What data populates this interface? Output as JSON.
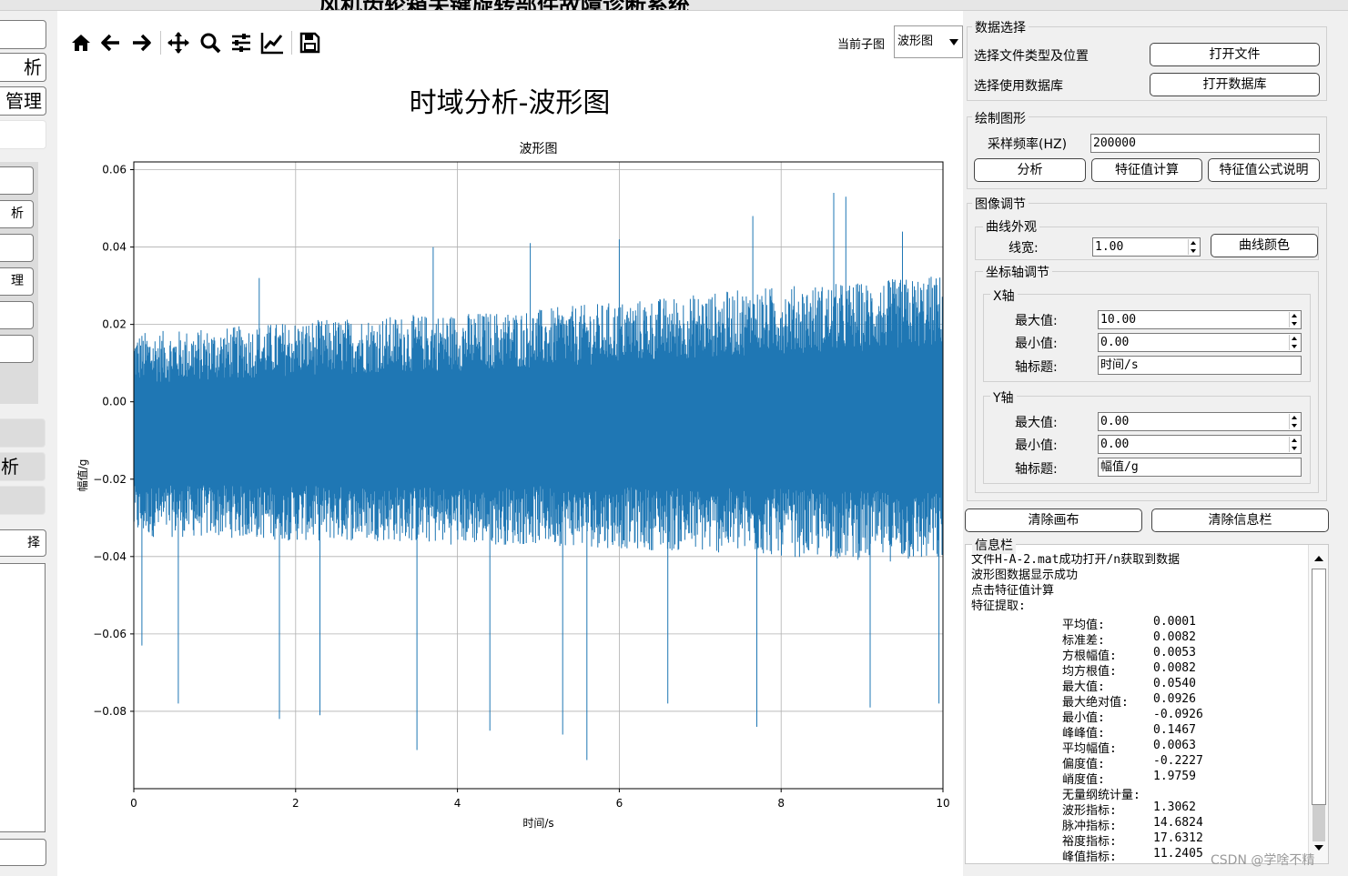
{
  "window": {
    "title": "风机齿轮箱关键旋转部件故障诊断系统"
  },
  "left_nav": {
    "main_buttons": [
      "",
      "析",
      "管理",
      ""
    ],
    "sub_buttons": [
      "",
      "析",
      "",
      "理",
      "",
      ""
    ],
    "gray_buttons": [
      "",
      "析",
      ""
    ],
    "bottom_button": "择"
  },
  "toolbar": {
    "icons": [
      "home-icon",
      "back-arrow-icon",
      "forward-arrow-icon",
      "pan-move-icon",
      "zoom-magnifier-icon",
      "configure-subplots-icon",
      "edit-axes-icon",
      "save-figure-icon"
    ],
    "subplot_label": "当前子图",
    "subplot_value": "波形图"
  },
  "figure": {
    "suptitle": "时域分析-波形图"
  },
  "chart_data": {
    "type": "line",
    "title": "波形图",
    "xlabel": "时间/s",
    "ylabel": "幅值/g",
    "xlim": [
      0,
      10
    ],
    "ylim": [
      -0.1,
      0.062
    ],
    "x_ticks": [
      "0",
      "2",
      "4",
      "6",
      "8",
      "10"
    ],
    "y_ticks": [
      "0.06",
      "0.04",
      "0.02",
      "0.00",
      "−0.02",
      "−0.04",
      "−0.06",
      "−0.08"
    ],
    "grid": true,
    "line_color": "#1f77b4",
    "envelope": {
      "x": [
        0,
        1,
        2,
        3,
        4,
        5,
        6,
        7,
        8,
        9,
        10
      ],
      "upper": [
        0.018,
        0.019,
        0.021,
        0.022,
        0.023,
        0.024,
        0.026,
        0.028,
        0.03,
        0.031,
        0.033
      ],
      "lower": [
        -0.035,
        -0.035,
        -0.036,
        -0.036,
        -0.037,
        -0.037,
        -0.038,
        -0.039,
        -0.04,
        -0.041,
        -0.042
      ]
    },
    "peaks_up": [
      {
        "x": 1.55,
        "y": 0.032
      },
      {
        "x": 3.7,
        "y": 0.04
      },
      {
        "x": 4.9,
        "y": 0.041
      },
      {
        "x": 6.0,
        "y": 0.042
      },
      {
        "x": 7.65,
        "y": 0.048
      },
      {
        "x": 8.65,
        "y": 0.054
      },
      {
        "x": 8.8,
        "y": 0.053
      },
      {
        "x": 9.5,
        "y": 0.044
      }
    ],
    "peaks_down": [
      {
        "x": 0.1,
        "y": -0.063
      },
      {
        "x": 0.55,
        "y": -0.078
      },
      {
        "x": 1.8,
        "y": -0.082
      },
      {
        "x": 2.3,
        "y": -0.081
      },
      {
        "x": 3.5,
        "y": -0.09
      },
      {
        "x": 4.4,
        "y": -0.085
      },
      {
        "x": 5.3,
        "y": -0.086
      },
      {
        "x": 5.6,
        "y": -0.0926
      },
      {
        "x": 6.6,
        "y": -0.078
      },
      {
        "x": 7.7,
        "y": -0.084
      },
      {
        "x": 9.1,
        "y": -0.079
      },
      {
        "x": 9.95,
        "y": -0.078
      }
    ]
  },
  "right_panel": {
    "data_select": {
      "title": "数据选择",
      "file_label": "选择文件类型及位置",
      "open_file": "打开文件",
      "db_label": "选择使用数据库",
      "open_db": "打开数据库"
    },
    "draw": {
      "title": "绘制图形",
      "rate_label": "采样频率(HZ)",
      "rate_value": "200000",
      "analyze": "分析",
      "feature_calc": "特征值计算",
      "formula": "特征值公式说明"
    },
    "image_adjust": {
      "title": "图像调节",
      "curve_title": "曲线外观",
      "line_width_label": "线宽:",
      "line_width_value": "1.00",
      "curve_color": "曲线颜色",
      "axis_title": "坐标轴调节",
      "x_axis": {
        "title": "X轴",
        "max_label": "最大值:",
        "max": "10.00",
        "min_label": "最小值:",
        "min": "0.00",
        "name_label": "轴标题:",
        "name": "时间/s"
      },
      "y_axis": {
        "title": "Y轴",
        "max_label": "最大值:",
        "max": "0.00",
        "min_label": "最小值:",
        "min": "0.00",
        "name_label": "轴标题:",
        "name": "幅值/g"
      }
    },
    "clear_canvas": "清除画布",
    "clear_info": "清除信息栏",
    "info": {
      "title": "信息栏",
      "lines": [
        "文件H-A-2.mat成功打开/n获取到数据",
        "波形图数据显示成功",
        "点击特征值计算",
        "特征提取:"
      ],
      "features": [
        {
          "name": "平均值:",
          "value": "0.0001"
        },
        {
          "name": "标准差:",
          "value": "0.0082"
        },
        {
          "name": "方根幅值:",
          "value": "0.0053"
        },
        {
          "name": "均方根值:",
          "value": "0.0082"
        },
        {
          "name": "最大值:",
          "value": "0.0540"
        },
        {
          "name": "最大绝对值:",
          "value": "0.0926"
        },
        {
          "name": "最小值:",
          "value": "-0.0926"
        },
        {
          "name": "峰峰值:",
          "value": "0.1467"
        },
        {
          "name": "平均幅值:",
          "value": "0.0063"
        },
        {
          "name": "偏度值:",
          "value": "-0.2227"
        },
        {
          "name": "峭度值:",
          "value": "1.9759"
        },
        {
          "name": "无量纲统计量:",
          "value": ""
        },
        {
          "name": "波形指标:",
          "value": "1.3062"
        },
        {
          "name": "脉冲指标:",
          "value": "14.6824"
        },
        {
          "name": "裕度指标:",
          "value": "17.6312"
        },
        {
          "name": "峰值指标:",
          "value": "11.2405"
        }
      ]
    }
  },
  "watermark": "CSDN @学啥不精"
}
